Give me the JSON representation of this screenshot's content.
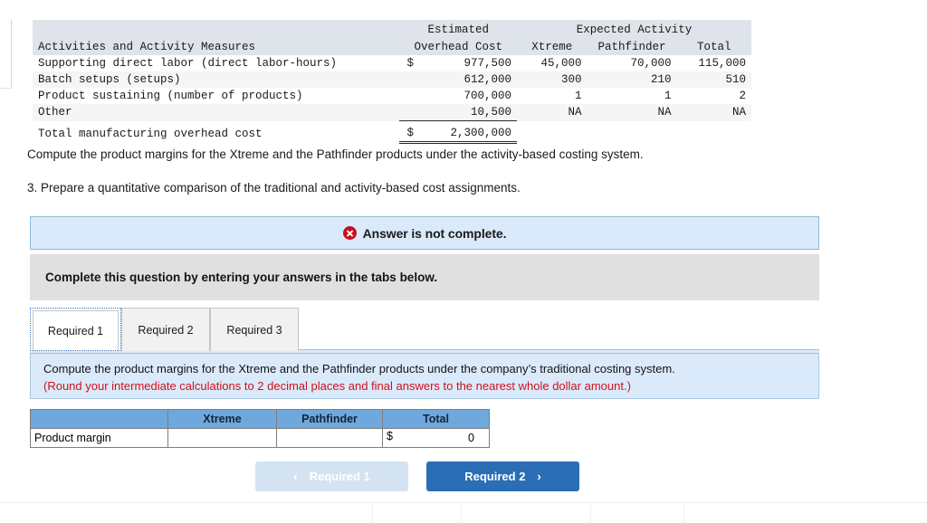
{
  "exhibit": {
    "headers": {
      "activities": "Activities and Activity Measures",
      "estimated": "Estimated",
      "overhead_cost": "Overhead Cost",
      "expected_activity": "Expected Activity",
      "xtreme": "Xtreme",
      "pathfinder": "Pathfinder",
      "total": "Total"
    },
    "rows": [
      {
        "label": "Supporting direct labor (direct labor-hours)",
        "dollar": "$",
        "cost": "977,500",
        "xtreme": "45,000",
        "pathfinder": "70,000",
        "total": "115,000"
      },
      {
        "label": "Batch setups (setups)",
        "dollar": "",
        "cost": "612,000",
        "xtreme": "300",
        "pathfinder": "210",
        "total": "510"
      },
      {
        "label": "Product sustaining (number of products)",
        "dollar": "",
        "cost": "700,000",
        "xtreme": "1",
        "pathfinder": "1",
        "total": "2"
      },
      {
        "label": "Other",
        "dollar": "",
        "cost": "10,500",
        "xtreme": "NA",
        "pathfinder": "NA",
        "total": "NA"
      }
    ],
    "total_row": {
      "label": "Total manufacturing overhead cost",
      "dollar": "$",
      "cost": "2,300,000"
    }
  },
  "prompts": {
    "line1": "Compute the product margins for the Xtreme and the Pathfinder products under the activity-based costing system.",
    "line2": "3. Prepare a quantitative comparison of the traditional and activity-based cost assignments."
  },
  "banner": {
    "icon": "error-x-icon",
    "text": "Answer is not complete.",
    "background": "#dbeafa",
    "icon_color": "#c4121a"
  },
  "instruction_bar": {
    "text": "Complete this question by entering your answers in the tabs below."
  },
  "tabs": {
    "items": [
      {
        "label": "Required 1",
        "active": true
      },
      {
        "label": "Required 2",
        "active": false
      },
      {
        "label": "Required 3",
        "active": false
      }
    ]
  },
  "requirement_panel": {
    "line1": "Compute the product margins for the Xtreme and the Pathfinder products under the company’s traditional costing system.",
    "line2": "(Round your intermediate calculations to 2 decimal places and final answers to the nearest whole dollar amount.)",
    "line2_color": "#d0101a",
    "background": "#dbeafa"
  },
  "answer_table": {
    "header_color": "#6fa8dc",
    "columns": [
      "",
      "Xtreme",
      "Pathfinder",
      "Total"
    ],
    "rows": [
      {
        "label": "Product margin",
        "xtreme": "",
        "pathfinder": "",
        "total_dollar": "$",
        "total": "0"
      }
    ]
  },
  "navigation": {
    "prev_label": "Required 1",
    "prev_chevron": "‹",
    "next_label": "Required 2",
    "next_chevron": "›",
    "next_color": "#2a6eb5",
    "prev_color": "#d3e3f2"
  }
}
